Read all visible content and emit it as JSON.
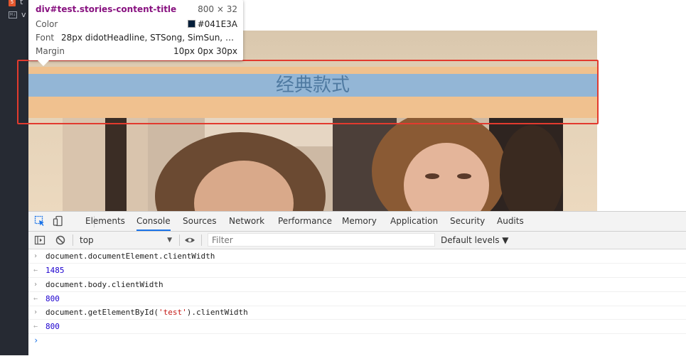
{
  "sidebar": {
    "files": [
      {
        "badge": "5",
        "name": "t"
      },
      {
        "badge": "M↓",
        "name": "v"
      }
    ]
  },
  "page": {
    "content_title": "经典款式"
  },
  "tooltip": {
    "selector_tag": "div",
    "selector_rest": "#test.stories-content-title",
    "dims": "800 × 32",
    "color_label": "Color",
    "color_value": "#041E3A",
    "color_swatch": "#041E3A",
    "font_label": "Font",
    "font_value": "28px didotHeadline, STSong, SimSun, san…",
    "margin_label": "Margin",
    "margin_value": "10px 0px 30px"
  },
  "devtools": {
    "tabs": [
      {
        "label": "Elements",
        "active": false
      },
      {
        "label": "Console",
        "active": true
      },
      {
        "label": "Sources",
        "active": false
      },
      {
        "label": "Network",
        "active": false
      },
      {
        "label": "Performance",
        "active": false
      },
      {
        "label": "Memory",
        "active": false
      },
      {
        "label": "Application",
        "active": false
      },
      {
        "label": "Security",
        "active": false
      },
      {
        "label": "Audits",
        "active": false
      }
    ],
    "context": "top",
    "filter_placeholder": "Filter",
    "levels": "Default levels ▼",
    "console_lines": [
      {
        "type": "input",
        "text": "document.documentElement.clientWidth"
      },
      {
        "type": "output",
        "text": "1485"
      },
      {
        "type": "input",
        "text": "document.body.clientWidth"
      },
      {
        "type": "output",
        "text": "800"
      },
      {
        "type": "input",
        "text_before": "document.getElementById(",
        "string": "'test'",
        "text_after": ").clientWidth"
      },
      {
        "type": "output",
        "text": "800"
      }
    ],
    "prompt": "›"
  },
  "colors": {
    "highlight_border": "#e23a2e",
    "active_tab_underline": "#1a73e8",
    "output_number": "#1c00cf"
  }
}
